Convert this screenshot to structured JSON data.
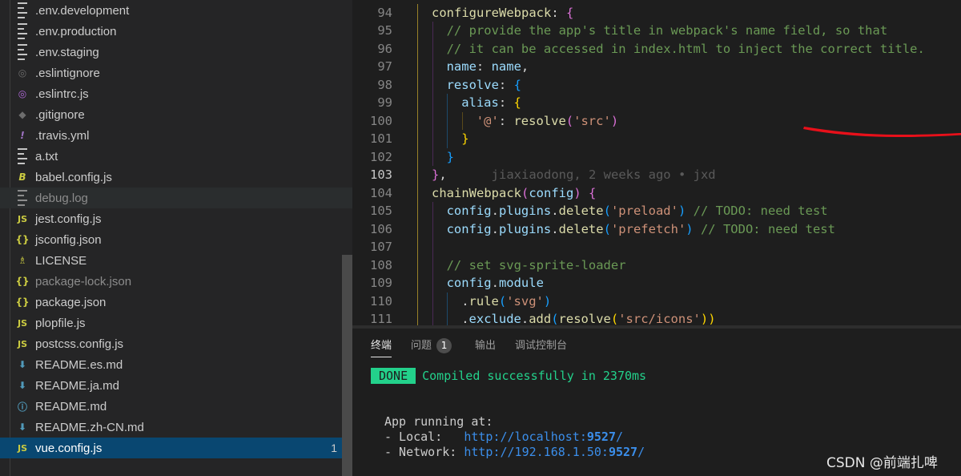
{
  "explorer": {
    "files": [
      {
        "name": ".env.development",
        "icon": "lines-icon",
        "color": "#c5c5c5"
      },
      {
        "name": ".env.production",
        "icon": "lines-icon",
        "color": "#c5c5c5"
      },
      {
        "name": ".env.staging",
        "icon": "lines-icon",
        "color": "#c5c5c5"
      },
      {
        "name": ".eslintignore",
        "icon": "eslint-gray-icon",
        "color": "#6d6d6d"
      },
      {
        "name": ".eslintrc.js",
        "icon": "eslint-icon",
        "color": "#b068d8"
      },
      {
        "name": ".gitignore",
        "icon": "git-icon",
        "color": "#6d6d6d"
      },
      {
        "name": ".travis.yml",
        "icon": "exclamation-icon",
        "color": "#a074c4"
      },
      {
        "name": "a.txt",
        "icon": "lines-icon",
        "color": "#c5c5c5"
      },
      {
        "name": "babel.config.js",
        "icon": "babel-icon",
        "color": "#cbcb41"
      },
      {
        "name": "debug.log",
        "icon": "lines-icon",
        "color": "#8c8c8c",
        "dim": true
      },
      {
        "name": "jest.config.js",
        "icon": "js-icon",
        "color": "#cbcb41"
      },
      {
        "name": "jsconfig.json",
        "icon": "json-icon",
        "color": "#cbcb41"
      },
      {
        "name": "LICENSE",
        "icon": "license-icon",
        "color": "#cbcb41"
      },
      {
        "name": "package-lock.json",
        "icon": "json-icon",
        "color": "#cbcb41",
        "dim": true
      },
      {
        "name": "package.json",
        "icon": "json-icon",
        "color": "#cbcb41"
      },
      {
        "name": "plopfile.js",
        "icon": "js-icon",
        "color": "#cbcb41"
      },
      {
        "name": "postcss.config.js",
        "icon": "js-icon",
        "color": "#cbcb41"
      },
      {
        "name": "README.es.md",
        "icon": "download-icon",
        "color": "#519aba"
      },
      {
        "name": "README.ja.md",
        "icon": "download-icon",
        "color": "#519aba"
      },
      {
        "name": "README.md",
        "icon": "info-icon",
        "color": "#519aba"
      },
      {
        "name": "README.zh-CN.md",
        "icon": "download-icon",
        "color": "#519aba"
      },
      {
        "name": "vue.config.js",
        "icon": "js-icon",
        "color": "#cbcb41",
        "active": true,
        "badge": "1"
      }
    ]
  },
  "editor": {
    "current_line": 103,
    "lines": [
      {
        "n": 94,
        "i": 0,
        "t": [
          [
            "t-fn",
            "configureWebpack"
          ],
          [
            "t-p",
            ": "
          ],
          [
            "t-br2",
            "{"
          ]
        ]
      },
      {
        "n": 95,
        "i": 1,
        "t": [
          [
            "t-com",
            "// provide the app's title in webpack's name field, so that"
          ]
        ]
      },
      {
        "n": 96,
        "i": 1,
        "t": [
          [
            "t-com",
            "// it can be accessed in index.html to inject the correct title."
          ]
        ]
      },
      {
        "n": 97,
        "i": 1,
        "t": [
          [
            "t-prop",
            "name"
          ],
          [
            "t-p",
            ": "
          ],
          [
            "t-prop",
            "name"
          ],
          [
            "t-p",
            ","
          ]
        ]
      },
      {
        "n": 98,
        "i": 1,
        "t": [
          [
            "t-prop",
            "resolve"
          ],
          [
            "t-p",
            ": "
          ],
          [
            "t-br3",
            "{"
          ]
        ]
      },
      {
        "n": 99,
        "i": 2,
        "t": [
          [
            "t-prop",
            "alias"
          ],
          [
            "t-p",
            ": "
          ],
          [
            "t-br1",
            "{"
          ]
        ]
      },
      {
        "n": 100,
        "i": 3,
        "t": [
          [
            "t-str",
            "'@'"
          ],
          [
            "t-p",
            ": "
          ],
          [
            "t-fn",
            "resolve"
          ],
          [
            "t-br2",
            "("
          ],
          [
            "t-str",
            "'src'"
          ],
          [
            "t-br2",
            ")"
          ]
        ]
      },
      {
        "n": 101,
        "i": 2,
        "t": [
          [
            "t-br1",
            "}"
          ]
        ]
      },
      {
        "n": 102,
        "i": 1,
        "t": [
          [
            "t-br3",
            "}"
          ]
        ]
      },
      {
        "n": 103,
        "i": 0,
        "t": [
          [
            "t-br2",
            "}"
          ],
          [
            "t-p",
            ","
          ],
          [
            "blame",
            "      jiaxiaodong, 2 weeks ago • jxd"
          ]
        ]
      },
      {
        "n": 104,
        "i": 0,
        "t": [
          [
            "t-fn",
            "chainWebpack"
          ],
          [
            "t-br2",
            "("
          ],
          [
            "t-prop",
            "config"
          ],
          [
            "t-br2",
            ")"
          ],
          [
            "t-p",
            " "
          ],
          [
            "t-br2",
            "{"
          ]
        ]
      },
      {
        "n": 105,
        "i": 1,
        "t": [
          [
            "t-prop",
            "config"
          ],
          [
            "t-p",
            "."
          ],
          [
            "t-prop",
            "plugins"
          ],
          [
            "t-p",
            "."
          ],
          [
            "t-fn",
            "delete"
          ],
          [
            "t-br3",
            "("
          ],
          [
            "t-str",
            "'preload'"
          ],
          [
            "t-br3",
            ")"
          ],
          [
            "t-p",
            " "
          ],
          [
            "t-com",
            "// TODO: need test"
          ]
        ]
      },
      {
        "n": 106,
        "i": 1,
        "t": [
          [
            "t-prop",
            "config"
          ],
          [
            "t-p",
            "."
          ],
          [
            "t-prop",
            "plugins"
          ],
          [
            "t-p",
            "."
          ],
          [
            "t-fn",
            "delete"
          ],
          [
            "t-br3",
            "("
          ],
          [
            "t-str",
            "'prefetch'"
          ],
          [
            "t-br3",
            ")"
          ],
          [
            "t-p",
            " "
          ],
          [
            "t-com",
            "// TODO: need test"
          ]
        ]
      },
      {
        "n": 107,
        "i": 1,
        "t": []
      },
      {
        "n": 108,
        "i": 1,
        "t": [
          [
            "t-com",
            "// set svg-sprite-loader"
          ]
        ]
      },
      {
        "n": 109,
        "i": 1,
        "t": [
          [
            "t-prop",
            "config"
          ],
          [
            "t-p",
            "."
          ],
          [
            "t-prop",
            "module"
          ]
        ]
      },
      {
        "n": 110,
        "i": 2,
        "t": [
          [
            "t-p",
            "."
          ],
          [
            "t-fn",
            "rule"
          ],
          [
            "t-br3",
            "("
          ],
          [
            "t-str",
            "'svg'"
          ],
          [
            "t-br3",
            ")"
          ]
        ]
      },
      {
        "n": 111,
        "i": 2,
        "t": [
          [
            "t-p",
            "."
          ],
          [
            "t-prop",
            "exclude"
          ],
          [
            "t-p",
            "."
          ],
          [
            "t-fn",
            "add"
          ],
          [
            "t-br3",
            "("
          ],
          [
            "t-fn",
            "resolve"
          ],
          [
            "t-br1",
            "("
          ],
          [
            "t-str",
            "'src/icons'"
          ],
          [
            "t-br1",
            "))"
          ]
        ]
      }
    ]
  },
  "panel": {
    "tabs": [
      {
        "label": "终端",
        "active": true
      },
      {
        "label": "问题",
        "badge": "1"
      },
      {
        "label": "输出"
      },
      {
        "label": "调试控制台"
      }
    ],
    "terminal": {
      "done_badge": "DONE",
      "compiled": "Compiled successfully in 2370ms",
      "running": "App running at:",
      "local_label": "- Local:   ",
      "local_url": "http://localhost:",
      "local_port": "9527",
      "local_suffix": "/",
      "network_label": "- Network: ",
      "network_url": "http://192.168.1.50:",
      "network_port": "9527",
      "network_suffix": "/"
    }
  },
  "watermark": "CSDN @前端扎啤",
  "colors": {
    "annotation": "#e8101a",
    "selection": "#094771",
    "done": "#23d18b"
  }
}
